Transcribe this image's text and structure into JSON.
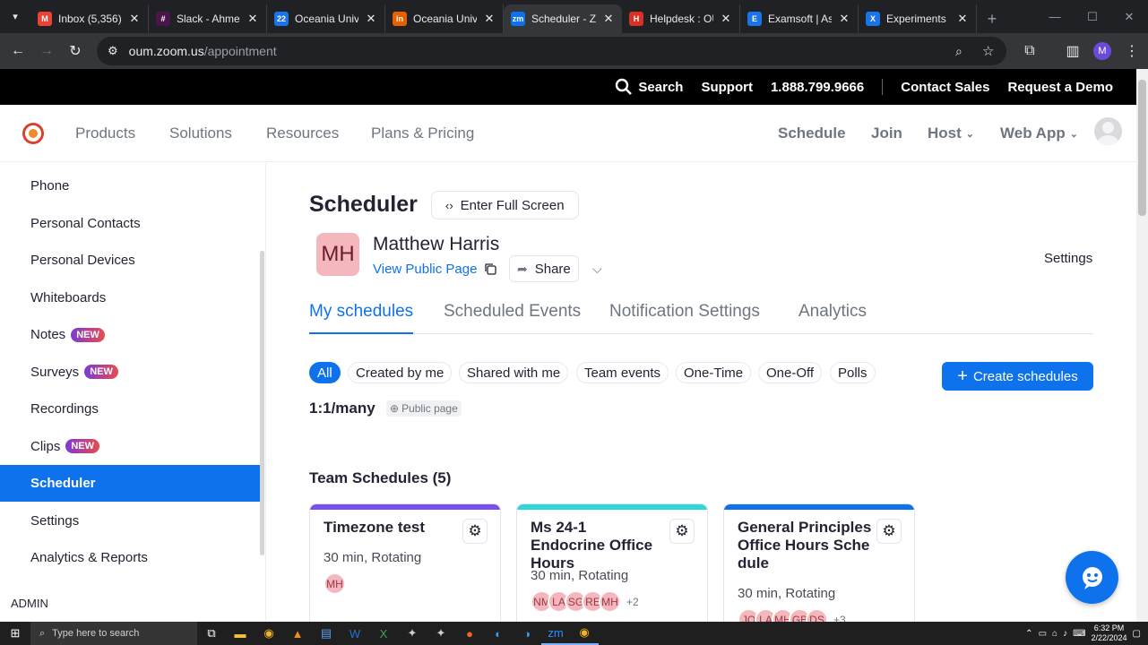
{
  "browser": {
    "tabs": [
      {
        "title": "Inbox (5,356)",
        "icon": "gmail-icon",
        "color": "#ea4335",
        "glyph": "M"
      },
      {
        "title": "Slack - Ahmed",
        "icon": "slack-icon",
        "color": "#4a154b",
        "glyph": "#"
      },
      {
        "title": "Oceania Unive",
        "icon": "calendar-icon",
        "color": "#1a73e8",
        "glyph": "22"
      },
      {
        "title": "Oceania Unive",
        "icon": "instructure-icon",
        "color": "#e66000",
        "glyph": "in"
      },
      {
        "title": "Scheduler - Z",
        "icon": "zoom-icon",
        "color": "#0e72ed",
        "glyph": "zm"
      },
      {
        "title": "Helpdesk : OU",
        "icon": "helpdesk-icon",
        "color": "#d93025",
        "glyph": "H"
      },
      {
        "title": "Examsoft | As",
        "icon": "examsoft-icon",
        "color": "#1a73e8",
        "glyph": "E"
      },
      {
        "title": "Experiments",
        "icon": "flask-icon",
        "color": "#1a73e8",
        "glyph": "X"
      }
    ],
    "url_host": "oum.zoom.us",
    "url_path": "/appointment",
    "profile_initial": "M"
  },
  "topbar": {
    "search": "Search",
    "support": "Support",
    "phone": "1.888.799.9666",
    "contact_sales": "Contact Sales",
    "request_demo": "Request a Demo"
  },
  "nav": {
    "left": [
      "Products",
      "Solutions",
      "Resources",
      "Plans & Pricing"
    ],
    "schedule": "Schedule",
    "join": "Join",
    "host": "Host",
    "web_app": "Web App"
  },
  "sidebar": {
    "items": [
      {
        "label": "Phone",
        "badge": ""
      },
      {
        "label": "Personal Contacts",
        "badge": ""
      },
      {
        "label": "Personal Devices",
        "badge": ""
      },
      {
        "label": "Whiteboards",
        "badge": ""
      },
      {
        "label": "Notes",
        "badge": "NEW"
      },
      {
        "label": "Surveys",
        "badge": "NEW"
      },
      {
        "label": "Recordings",
        "badge": ""
      },
      {
        "label": "Clips",
        "badge": "NEW"
      },
      {
        "label": "Scheduler",
        "badge": "",
        "active": true
      },
      {
        "label": "Settings",
        "badge": ""
      },
      {
        "label": "Analytics & Reports",
        "badge": ""
      }
    ],
    "admin": "ADMIN"
  },
  "main": {
    "title": "Scheduler",
    "fullscreen": "Enter Full Screen",
    "initials": "MH",
    "name": "Matthew Harris",
    "view_public": "View Public Page",
    "share": "Share",
    "settings": "Settings",
    "tabs": [
      "My schedules",
      "Scheduled Events",
      "Notification Settings",
      "Analytics"
    ],
    "filters": [
      "All",
      "Created by me",
      "Shared with me",
      "Team events",
      "One-Time",
      "One-Off",
      "Polls"
    ],
    "create": "Create schedules",
    "section_one": "1:1/many",
    "public_page": "Public page",
    "section_team": "Team Schedules (5)",
    "cards": [
      {
        "title": "Timezone test",
        "meta": "30 min, Rotating",
        "color": "#7a4ff0",
        "avatars": [
          "MH"
        ],
        "more": ""
      },
      {
        "title": "Ms 24-1 Endocrine Office Hours",
        "meta": "30 min, Rotating",
        "color": "#2fd7d7",
        "avatars": [
          "NM",
          "LA",
          "SG",
          "RE",
          "MH"
        ],
        "more": "+2"
      },
      {
        "title": "General Principles Office Hours Sche dule",
        "meta": "30 min, Rotating",
        "color": "#0e72ed",
        "avatars": [
          "JO",
          "LA",
          "MH",
          "GB",
          "DS"
        ],
        "more": "+3"
      }
    ]
  },
  "taskbar": {
    "search_placeholder": "Type here to search",
    "time": "6:32 PM",
    "date": "2/22/2024"
  }
}
